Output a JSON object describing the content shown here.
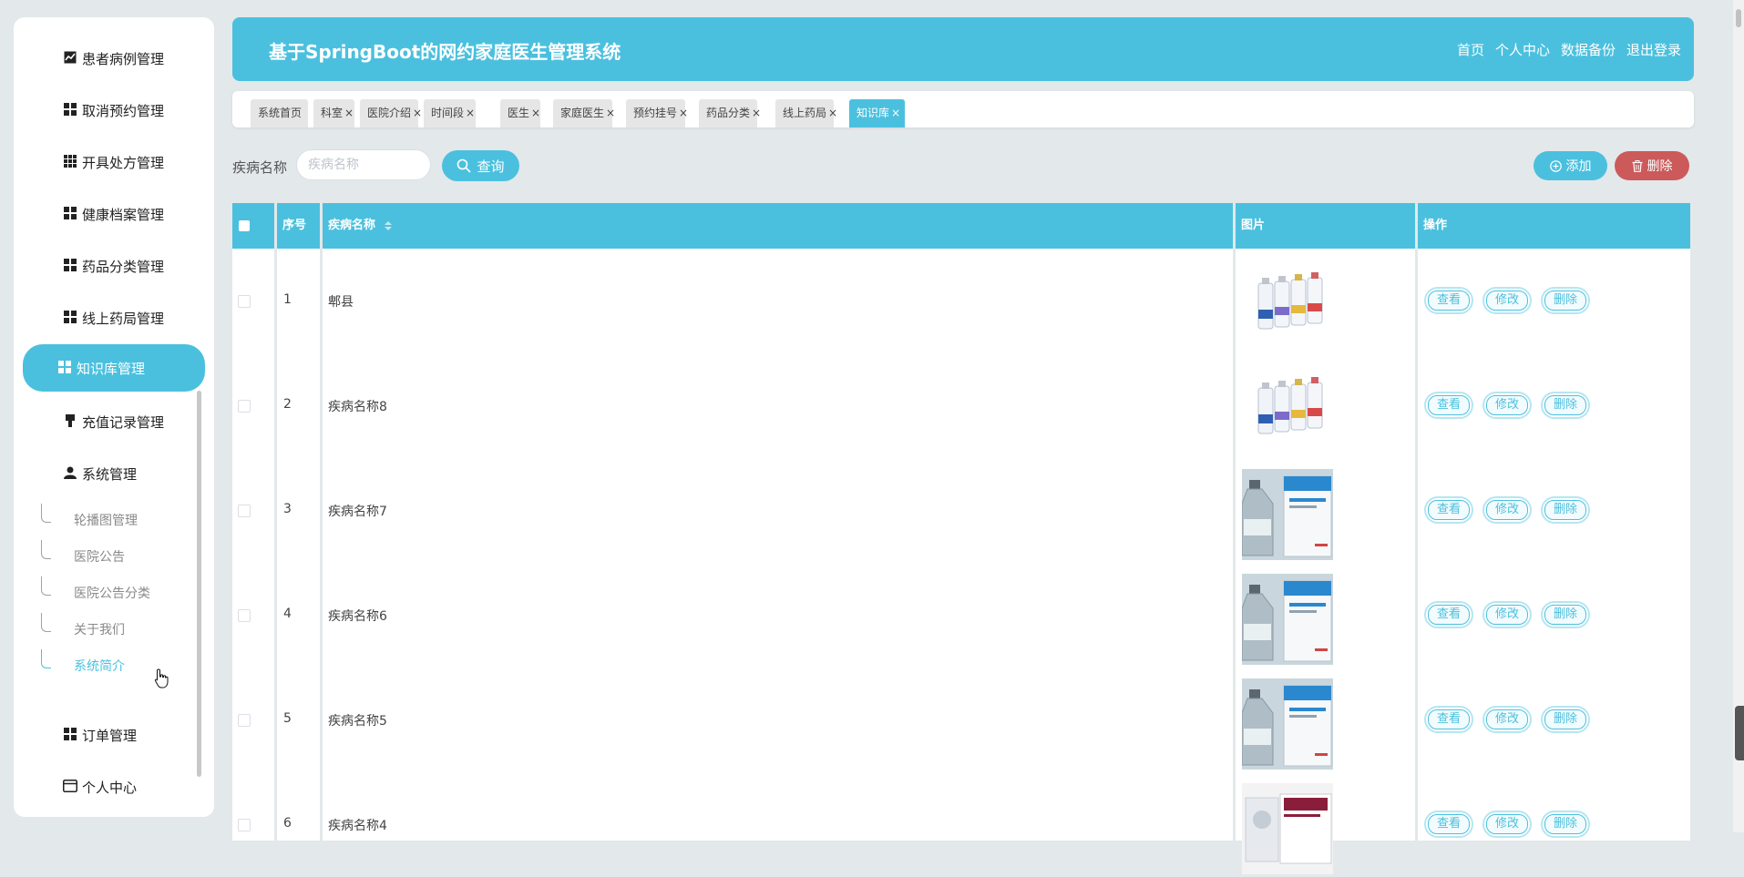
{
  "app": {
    "title": "基于SpringBoot的网约家庭医生管理系统",
    "nav": [
      "首页",
      "个人中心",
      "数据备份",
      "退出登录"
    ]
  },
  "sidebar": {
    "items": [
      {
        "label": "患者病例管理",
        "icon": "chart-icon"
      },
      {
        "label": "取消预约管理",
        "icon": "grid-icon"
      },
      {
        "label": "开具处方管理",
        "icon": "apps-icon"
      },
      {
        "label": "健康档案管理",
        "icon": "grid-icon"
      },
      {
        "label": "药品分类管理",
        "icon": "grid-icon"
      },
      {
        "label": "线上药局管理",
        "icon": "grid-icon"
      },
      {
        "label": "知识库管理",
        "icon": "grid-icon",
        "active": true
      },
      {
        "label": "充值记录管理",
        "icon": "pin-icon"
      },
      {
        "label": "系统管理",
        "icon": "user-icon"
      }
    ],
    "sub_items": [
      {
        "label": "轮播图管理"
      },
      {
        "label": "医院公告"
      },
      {
        "label": "医院公告分类"
      },
      {
        "label": "关于我们"
      },
      {
        "label": "系统简介",
        "active": true
      }
    ],
    "bottom_items": [
      {
        "label": "订单管理",
        "icon": "grid-icon"
      },
      {
        "label": "个人中心",
        "icon": "card-icon"
      }
    ]
  },
  "tabs": [
    {
      "label": "系统首页",
      "closable": false
    },
    {
      "label": "科室",
      "closable": true
    },
    {
      "label": "医院介绍",
      "closable": true
    },
    {
      "label": "时间段",
      "closable": true
    },
    {
      "label": "医生",
      "closable": true
    },
    {
      "label": "家庭医生",
      "closable": true
    },
    {
      "label": "预约挂号",
      "closable": true
    },
    {
      "label": "药品分类",
      "closable": true
    },
    {
      "label": "线上药局",
      "closable": true
    },
    {
      "label": "知识库",
      "closable": true,
      "active": true
    }
  ],
  "search": {
    "label": "疾病名称",
    "placeholder": "疾病名称",
    "value": "",
    "query_label": "查询"
  },
  "actions": {
    "add_label": "添加",
    "delete_label": "删除"
  },
  "table": {
    "headers": {
      "index": "序号",
      "name": "疾病名称",
      "image": "图片",
      "ops": "操作"
    },
    "row_ops": [
      "查看",
      "修改",
      "删除"
    ],
    "rows": [
      {
        "index": "1",
        "name": "郫县",
        "image": "vials"
      },
      {
        "index": "2",
        "name": "疾病名称8",
        "image": "vials"
      },
      {
        "index": "3",
        "name": "疾病名称7",
        "image": "bottle-box"
      },
      {
        "index": "4",
        "name": "疾病名称6",
        "image": "bottle-box"
      },
      {
        "index": "5",
        "name": "疾病名称5",
        "image": "bottle-box"
      },
      {
        "index": "6",
        "name": "疾病名称4",
        "image": "pill-box"
      }
    ]
  },
  "colors": {
    "accent": "#4bc0de",
    "danger": "#cc5a5a",
    "background": "#e3e8ea"
  }
}
